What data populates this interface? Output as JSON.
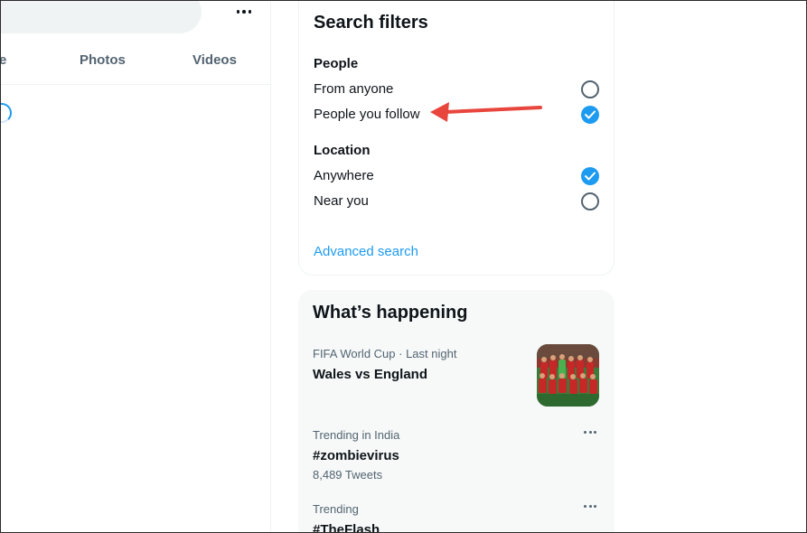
{
  "left": {
    "tab_partial": "e",
    "tabs": [
      "Photos",
      "Videos"
    ],
    "more_icon": "more-horizontal-icon"
  },
  "filters": {
    "title": "Search filters",
    "people": {
      "heading": "People",
      "options": [
        {
          "label": "From anyone",
          "checked": false
        },
        {
          "label": "People you follow",
          "checked": true
        }
      ]
    },
    "location": {
      "heading": "Location",
      "options": [
        {
          "label": "Anywhere",
          "checked": true
        },
        {
          "label": "Near you",
          "checked": false
        }
      ]
    },
    "advanced_link": "Advanced search"
  },
  "happening": {
    "title": "What’s happening",
    "trends": [
      {
        "meta": "FIFA World Cup · Last night",
        "name": "Wales vs England",
        "count": ""
      },
      {
        "meta": "Trending in India",
        "name": "#zombievirus",
        "count": "8,489 Tweets"
      },
      {
        "meta": "Trending",
        "name": "#TheFlash",
        "count": ""
      }
    ]
  },
  "colors": {
    "accent": "#1d9bf0",
    "arrow": "#e8453c",
    "text_secondary": "#536471"
  }
}
